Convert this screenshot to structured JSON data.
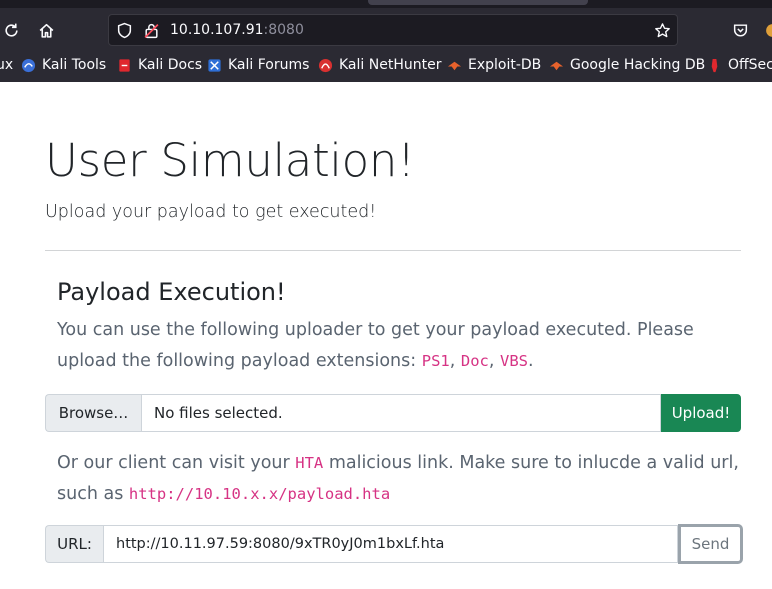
{
  "browser": {
    "url_host": "10.10.107.91",
    "url_port": ":8080",
    "bookmarks": [
      {
        "label": "ux"
      },
      {
        "label": "Kali Tools"
      },
      {
        "label": "Kali Docs"
      },
      {
        "label": "Kali Forums"
      },
      {
        "label": "Kali NetHunter"
      },
      {
        "label": "Exploit-DB"
      },
      {
        "label": "Google Hacking DB"
      },
      {
        "label": "OffSec"
      }
    ]
  },
  "page": {
    "title": "User Simulation!",
    "lead": "Upload your payload to get executed!",
    "section_title": "Payload Execution!",
    "para1": {
      "text_before": "You can use the following uploader to get your payload executed. Please upload the following payload extensions: ",
      "ext1": "PS1",
      "sep1": ", ",
      "ext2": "Doc",
      "sep2": ", ",
      "ext3": "VBS",
      "end": "."
    },
    "uploader": {
      "browse_label": "Browse…",
      "file_status": "No files selected.",
      "upload_label": "Upload!"
    },
    "para2": {
      "text_before": "Or our client can visit your ",
      "code1": "HTA",
      "text_mid": " malicious link. Make sure to inlucde a valid url, such as ",
      "code2": "http://10.10.x.x/payload.hta"
    },
    "url_form": {
      "label": "URL:",
      "value": "http://10.11.97.59:8080/9xTR0yJ0m1bxLf.hta",
      "send_label": "Send"
    }
  }
}
